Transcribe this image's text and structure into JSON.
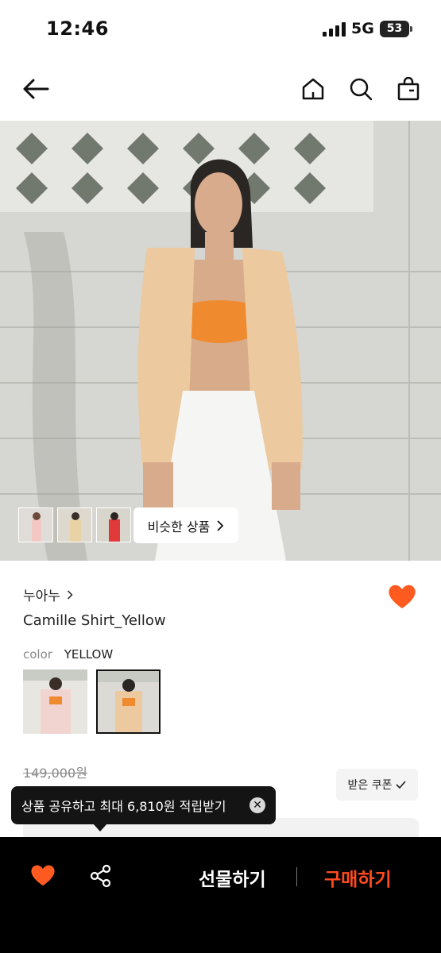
{
  "status_bar": {
    "time": "12:46",
    "network": "5G",
    "battery": "53"
  },
  "nav": {
    "back_icon": "arrow-left-icon",
    "home_icon": "home-icon",
    "search_icon": "search-icon",
    "bag_icon": "shopping-bag-icon"
  },
  "hero": {
    "similar_label": "비슷한 상품"
  },
  "product": {
    "brand": "누아누",
    "name": "Camille Shirt_Yellow",
    "color_label": "color",
    "color_value": "YELLOW",
    "original_price": "149,000원",
    "coupon_label": "받은 쿠폰"
  },
  "tooltip": {
    "text": "상품 공유하고 최대 6,810원 적립받기"
  },
  "bottom_bar": {
    "gift_label": "선물하기",
    "buy_label": "구매하기"
  },
  "colors": {
    "accent": "#ff4b1f",
    "heart": "#ff5a1f",
    "bar_bg": "#000000"
  }
}
